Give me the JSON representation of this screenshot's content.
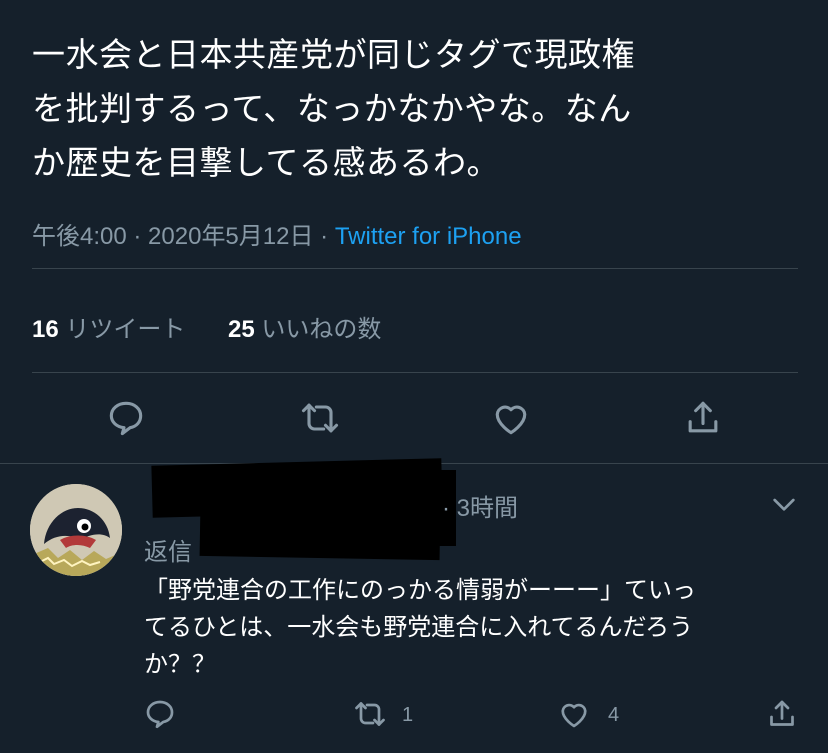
{
  "tweet": {
    "text": "一水会と日本共産党が同じタグで現政権\nを批判するって、なっかなかやな。なん\nか歴史を目撃してる感あるわ。",
    "time": "午後4:00",
    "sep": " · ",
    "date": "2020年5月12日",
    "source": "Twitter for iPhone",
    "retweets_count": "16",
    "retweets_label": "リツイート",
    "likes_count": "25",
    "likes_label": "いいねの数"
  },
  "colors": {
    "background": "#15202b",
    "accent": "#1da1f2",
    "muted": "#8899a6",
    "divider": "#38444d"
  },
  "icons": [
    "reply-icon",
    "retweet-icon",
    "like-icon",
    "share-icon",
    "chevron-down-icon"
  ],
  "reply": {
    "time": "· 3時間",
    "reply_prefix": "返信",
    "text": "「野党連合の工作にのっかる情弱がーーー」ていっ\nてるひとは、一水会も野党連合に入れてるんだろう\nか？？",
    "retweet_count": "1",
    "like_count": "4"
  }
}
